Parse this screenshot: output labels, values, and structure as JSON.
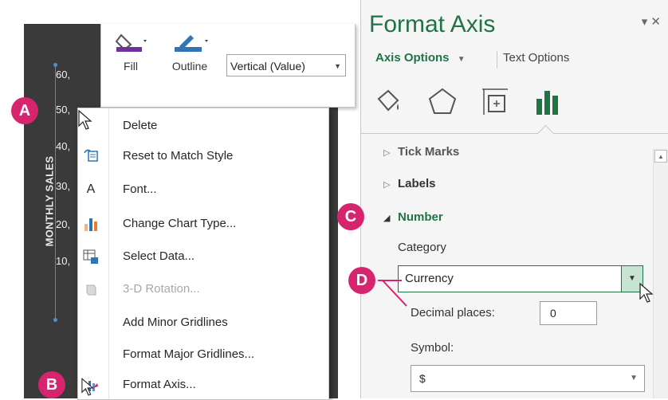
{
  "chart": {
    "y_axis_title": "MONTHLY SALES",
    "tick_labels": [
      "60,",
      "50,",
      "40,",
      "30,",
      "20,",
      "10,"
    ]
  },
  "mini_toolbar": {
    "fill_label": "Fill",
    "outline_label": "Outline",
    "element_dropdown_value": "Vertical (Value)"
  },
  "context_menu": {
    "items": [
      {
        "label": "Delete",
        "icon": "none",
        "enabled": true
      },
      {
        "label": "Reset to Match Style",
        "icon": "reset-style-icon",
        "enabled": true
      },
      {
        "label": "Font...",
        "icon": "font-icon",
        "enabled": true
      },
      {
        "label": "Change Chart Type...",
        "icon": "chart-type-icon",
        "enabled": true
      },
      {
        "label": "Select Data...",
        "icon": "select-data-icon",
        "enabled": true
      },
      {
        "label": "3-D Rotation...",
        "icon": "cube-icon",
        "enabled": false
      },
      {
        "label": "Add Minor Gridlines",
        "icon": "none",
        "enabled": true
      },
      {
        "label": "Format Major Gridlines...",
        "icon": "none",
        "enabled": true
      },
      {
        "label": "Format Axis...",
        "icon": "format-axis-icon",
        "enabled": true
      }
    ]
  },
  "callouts": {
    "a": "A",
    "b": "B",
    "c": "C",
    "d": "D"
  },
  "format_pane": {
    "title": "Format Axis",
    "controls": "▾ ✕",
    "tabs": {
      "axis_options": "Axis Options",
      "text_options": "Text Options"
    },
    "sections": {
      "tick_marks": "Tick Marks",
      "labels": "Labels",
      "number": "Number"
    },
    "category_label": "Category",
    "category_value": "Currency",
    "decimal_label": "Decimal places:",
    "decimal_value": "0",
    "symbol_label": "Symbol:",
    "symbol_value": "$"
  },
  "colors": {
    "accent_green": "#217346",
    "callout_pink": "#d6246e",
    "chart_bg": "#3a3a3a"
  }
}
